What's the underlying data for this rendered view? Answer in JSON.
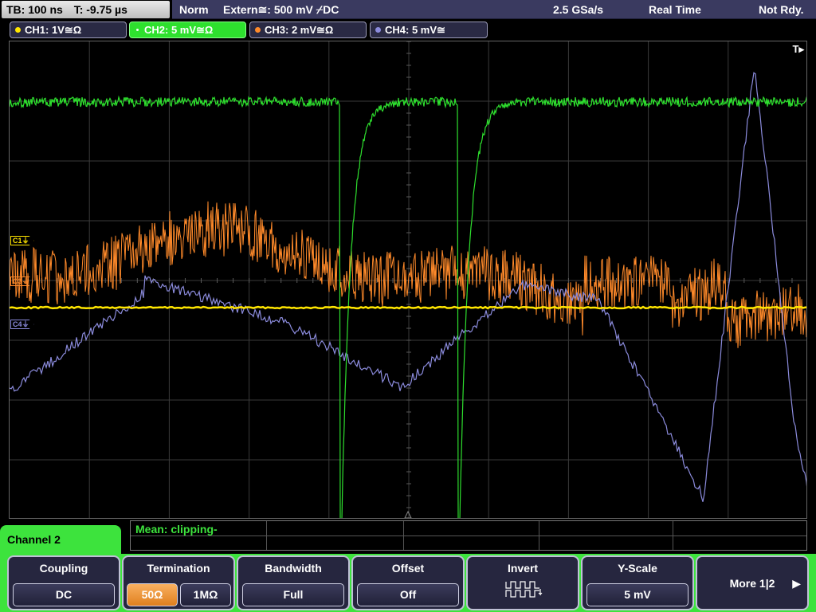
{
  "topbar": {
    "timebase": "TB: 100 ns",
    "trigger_pos": "T: -9.75 µs",
    "trigger_mode": "Norm",
    "trigger_source": "Extern≅: 500 mV ⌿DC",
    "sample_rate": "2.5 GSa/s",
    "acq_mode": "Real Time",
    "status": "Not Rdy."
  },
  "channels": [
    {
      "label": "CH1: 1V≅Ω",
      "color": "#ffe600",
      "active": false
    },
    {
      "label": "CH2: 5 mV≅Ω",
      "color": "#2ee02e",
      "active": true
    },
    {
      "label": "CH3: 2 mV≅Ω",
      "color": "#ff8a2a",
      "active": false
    },
    {
      "label": "CH4: 5 mV≅",
      "color": "#8b8bdc",
      "active": false
    }
  ],
  "markers": {
    "c1": "C1⏚",
    "c3": "C3⏚",
    "c4": "C4⏚",
    "trigger": "T▸"
  },
  "measurement": {
    "text": "Mean: clipping-"
  },
  "menu": {
    "title": "Channel 2",
    "coupling": {
      "title": "Coupling",
      "value": "DC"
    },
    "termination": {
      "title": "Termination",
      "opt1": "50Ω",
      "opt2": "1MΩ"
    },
    "bandwidth": {
      "title": "Bandwidth",
      "value": "Full"
    },
    "offset": {
      "title": "Offset",
      "value": "Off"
    },
    "invert": {
      "title": "Invert"
    },
    "yscale": {
      "title": "Y-Scale",
      "value": "5 mV"
    },
    "more": {
      "label": "More 1|2"
    }
  },
  "colors": {
    "ch1": "#ffe600",
    "ch2": "#2ee02e",
    "ch3": "#ff8a2a",
    "ch4": "#8b8bdc",
    "menu_accent": "#3de33d"
  }
}
